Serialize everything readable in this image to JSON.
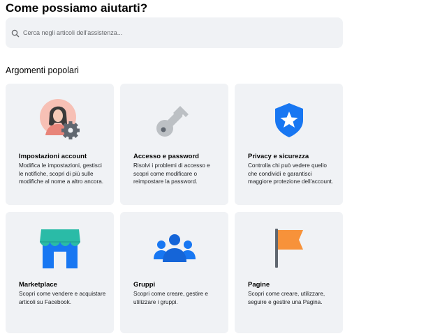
{
  "header": {
    "title": "Come possiamo aiutarti?"
  },
  "search": {
    "placeholder": "Cerca negli articoli dell'assistenza...",
    "icon": "search-icon"
  },
  "popular": {
    "heading": "Argomenti popolari",
    "cards": [
      {
        "title": "Impostazioni account",
        "description": "Modifica le impostazioni, gestisci le notifiche, scopri di più sulle modifiche al nome a altro ancora.",
        "icon": "account-settings-icon"
      },
      {
        "title": "Accesso e password",
        "description": "Risolvi i problemi di accesso e scopri come modificare o reimpostare la password.",
        "icon": "key-icon"
      },
      {
        "title": "Privacy e sicurezza",
        "description": "Controlla chi può vedere quello che condividi e garantisci maggiore protezione dell'account.",
        "icon": "shield-star-icon"
      },
      {
        "title": "Marketplace",
        "description": "Scopri come vendere e acquistare articoli su Facebook.",
        "icon": "marketplace-store-icon"
      },
      {
        "title": "Gruppi",
        "description": "Scopri come creare, gestire e utilizzare i gruppi.",
        "icon": "groups-icon"
      },
      {
        "title": "Pagine",
        "description": "Scopri come creare, utilizzare, seguire e gestire una Pagina.",
        "icon": "flag-icon"
      }
    ]
  },
  "colors": {
    "card_background": "#f0f2f5",
    "facebook_blue": "#1877f2",
    "teal": "#2abba7",
    "flag_orange": "#f7923a",
    "key_gray": "#bcc0c4"
  }
}
